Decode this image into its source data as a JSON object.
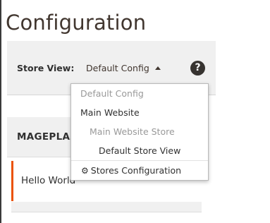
{
  "page": {
    "title": "Configuration"
  },
  "store_switcher": {
    "label": "Store View:",
    "selected": "Default Config",
    "help_icon": "question-circle-icon"
  },
  "dropdown": {
    "default_config": "Default Config",
    "website": "Main Website",
    "store": "Main Website Store",
    "store_view": "Default Store View",
    "footer_label": "Stores Configuration",
    "footer_icon": "gear-icon"
  },
  "config_tabs": {
    "section_title": "MAGEPLAZA",
    "items": [
      {
        "label": "Hello World"
      }
    ]
  },
  "colors": {
    "accent": "#eb5202",
    "panel_bg": "#f0f0f0",
    "dark": "#41362f"
  }
}
